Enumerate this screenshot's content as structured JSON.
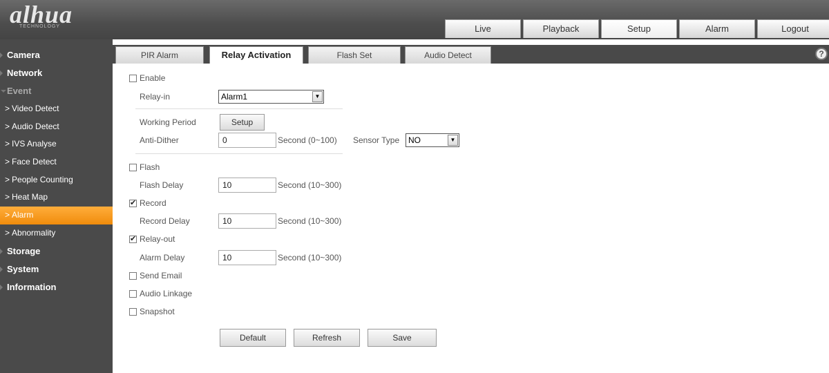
{
  "logo": {
    "name": "alhua",
    "sub": "TECHNOLOGY"
  },
  "topnav": [
    "Live",
    "Playback",
    "Setup",
    "Alarm",
    "Logout"
  ],
  "sidebar": {
    "items": [
      {
        "label": "Camera",
        "type": "cat"
      },
      {
        "label": "Network",
        "type": "cat"
      },
      {
        "label": "Event",
        "type": "cat-open"
      },
      {
        "label": "Video Detect",
        "type": "sub"
      },
      {
        "label": "Audio Detect",
        "type": "sub"
      },
      {
        "label": "IVS Analyse",
        "type": "sub"
      },
      {
        "label": "Face Detect",
        "type": "sub"
      },
      {
        "label": "People Counting",
        "type": "sub"
      },
      {
        "label": "Heat Map",
        "type": "sub"
      },
      {
        "label": "Alarm",
        "type": "sub-active"
      },
      {
        "label": "Abnormality",
        "type": "sub"
      },
      {
        "label": "Storage",
        "type": "cat"
      },
      {
        "label": "System",
        "type": "cat"
      },
      {
        "label": "Information",
        "type": "cat"
      }
    ]
  },
  "tabs": [
    "PIR Alarm",
    "Relay Activation",
    "Flash Set",
    "Audio Detect"
  ],
  "help": "?",
  "form": {
    "enable": "Enable",
    "relay_in": {
      "label": "Relay-in",
      "value": "Alarm1"
    },
    "working_period": {
      "label": "Working Period",
      "button": "Setup"
    },
    "anti_dither": {
      "label": "Anti-Dither",
      "value": "0",
      "unit": "Second (0~100)"
    },
    "sensor_type": {
      "label": "Sensor Type",
      "value": "NO"
    },
    "flash": "Flash",
    "flash_delay": {
      "label": "Flash Delay",
      "value": "10",
      "unit": "Second (10~300)"
    },
    "record": "Record",
    "record_delay": {
      "label": "Record Delay",
      "value": "10",
      "unit": "Second (10~300)"
    },
    "relay_out": "Relay-out",
    "alarm_delay": {
      "label": "Alarm Delay",
      "value": "10",
      "unit": "Second (10~300)"
    },
    "send_email": "Send Email",
    "audio_linkage": "Audio Linkage",
    "snapshot": "Snapshot"
  },
  "buttons": {
    "default": "Default",
    "refresh": "Refresh",
    "save": "Save"
  }
}
